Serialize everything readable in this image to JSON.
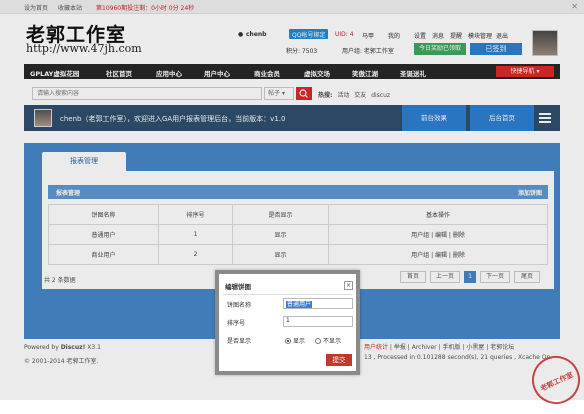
{
  "topbar": {
    "set_home": "设为首页",
    "bookmark": "收藏本站",
    "notice": "第10960期投注剩：0小时 0分 24秒",
    "close": "✕"
  },
  "header": {
    "logo_cn": "老郭工作室",
    "logo_url": "http://www.47jh.com",
    "username": "chenb",
    "qq_bind": "QQ帐号绑定",
    "uid": "UID: 4",
    "menu": [
      "马甲",
      "我的",
      "设置",
      "消息",
      "提醒",
      "模块管理",
      "退出"
    ],
    "points": "积分: 7503",
    "usergroup": "用户组: 老郭工作室",
    "reward_btn": "今日奖励已领取",
    "signed_btn": "已签到"
  },
  "nav": {
    "items": [
      "GPLAY虚拟花园",
      "社区首页",
      "应用中心",
      "用户中心",
      "商业会员",
      "虚拟交场",
      "笑傲江湖",
      "圣诞送礼"
    ],
    "quick": "快捷导航"
  },
  "search": {
    "placeholder": "请输入搜索内容",
    "type": "帖子",
    "hot_label": "热搜:",
    "hot_words": [
      "活动",
      "交友",
      "discuz"
    ]
  },
  "welcome": {
    "text": "chenb（老郭工作室），欢迎进入GA用户报表管理后台，当前版本：v1.0",
    "front_btn": "前台效果",
    "back_btn": "后台首页"
  },
  "panel": {
    "tab": "报表管理",
    "table_title": "报表管理",
    "add_link": "添加饼图",
    "columns": [
      "饼图名称",
      "排序号",
      "是否显示",
      "基本操作"
    ],
    "rows": [
      {
        "name": "普通用户",
        "order": "1",
        "show": "显示",
        "ops": "用户组 | 编辑 | 删除"
      },
      {
        "name": "商业用户",
        "order": "2",
        "show": "显示",
        "ops": "用户组 | 编辑 | 删除"
      }
    ],
    "total": "共 2 条数据",
    "pager": {
      "first": "首页",
      "prev": "上一页",
      "current": "1",
      "next": "下一页",
      "last": "尾页"
    }
  },
  "footer": {
    "powered": "Powered by",
    "discuz": "Discuz!",
    "version": "X3.1",
    "copyright": "© 2001-2014 老郭工作室.",
    "links": [
      "用户统计",
      "举报",
      "Archiver",
      "手机版",
      "小黑屋",
      "老郭论坛"
    ],
    "gzip": "13 , Processed in 0.101288 second(s), 21 queries , Xcache On."
  },
  "modal": {
    "title": "编辑饼图",
    "close": "×",
    "name_label": "饼图名称",
    "name_value": "普通用户",
    "order_label": "排序号",
    "order_value": "1",
    "show_label": "是否显示",
    "show_yes": "显示",
    "show_no": "不显示",
    "submit": "提交"
  },
  "stamp": "老郭工作室",
  "colors": {
    "nav": "#282828",
    "welcome": "#2f4f6d",
    "panel": "#4688c8",
    "accent_red": "#e02828",
    "signed": "#2e7fd0"
  }
}
